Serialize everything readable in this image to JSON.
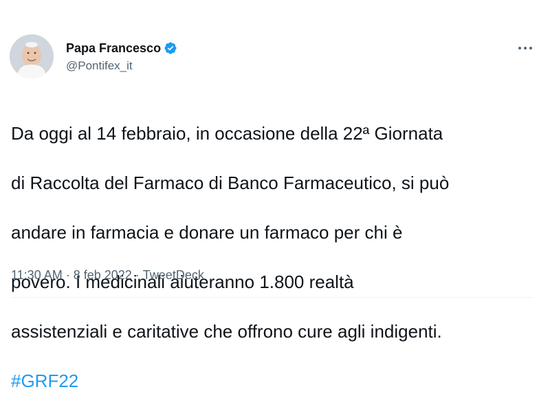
{
  "author": {
    "name": "Papa Francesco",
    "handle": "@Pontifex_it"
  },
  "icons": {
    "avatar": "avatar-photo",
    "verified": "verified-badge-icon",
    "more": "more-options-icon"
  },
  "colors": {
    "link": "#1d9bf0",
    "verified": "#1d9bf0",
    "secondary_text": "#536471",
    "text": "#0f1419"
  },
  "tweet": {
    "text_lines": [
      "Da oggi al 14 febbraio, in occasione della 22ª Giornata",
      "di Raccolta del Farmaco di Banco Farmaceutico, si può",
      "andare in farmacia e donare un farmaco per chi è",
      "povero. I medicinali aiuteranno 1.800 realtà",
      "assistenziali e caritative che offrono cure agli indigenti."
    ],
    "hashtag": "#GRF22"
  },
  "meta": {
    "time": "11:30 AM",
    "separator": " · ",
    "date": "8 feb 2022",
    "source": "TweetDeck"
  }
}
